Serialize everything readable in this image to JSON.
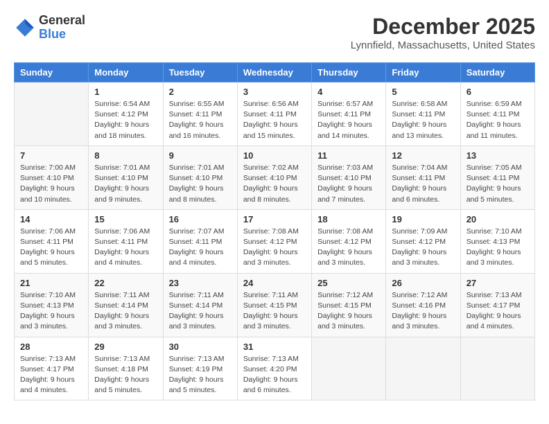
{
  "header": {
    "logo_line1": "General",
    "logo_line2": "Blue",
    "month_title": "December 2025",
    "location": "Lynnfield, Massachusetts, United States"
  },
  "calendar": {
    "weekdays": [
      "Sunday",
      "Monday",
      "Tuesday",
      "Wednesday",
      "Thursday",
      "Friday",
      "Saturday"
    ],
    "weeks": [
      [
        {
          "day": "",
          "info": ""
        },
        {
          "day": "1",
          "info": "Sunrise: 6:54 AM\nSunset: 4:12 PM\nDaylight: 9 hours\nand 18 minutes."
        },
        {
          "day": "2",
          "info": "Sunrise: 6:55 AM\nSunset: 4:11 PM\nDaylight: 9 hours\nand 16 minutes."
        },
        {
          "day": "3",
          "info": "Sunrise: 6:56 AM\nSunset: 4:11 PM\nDaylight: 9 hours\nand 15 minutes."
        },
        {
          "day": "4",
          "info": "Sunrise: 6:57 AM\nSunset: 4:11 PM\nDaylight: 9 hours\nand 14 minutes."
        },
        {
          "day": "5",
          "info": "Sunrise: 6:58 AM\nSunset: 4:11 PM\nDaylight: 9 hours\nand 13 minutes."
        },
        {
          "day": "6",
          "info": "Sunrise: 6:59 AM\nSunset: 4:11 PM\nDaylight: 9 hours\nand 11 minutes."
        }
      ],
      [
        {
          "day": "7",
          "info": "Sunrise: 7:00 AM\nSunset: 4:10 PM\nDaylight: 9 hours\nand 10 minutes."
        },
        {
          "day": "8",
          "info": "Sunrise: 7:01 AM\nSunset: 4:10 PM\nDaylight: 9 hours\nand 9 minutes."
        },
        {
          "day": "9",
          "info": "Sunrise: 7:01 AM\nSunset: 4:10 PM\nDaylight: 9 hours\nand 8 minutes."
        },
        {
          "day": "10",
          "info": "Sunrise: 7:02 AM\nSunset: 4:10 PM\nDaylight: 9 hours\nand 8 minutes."
        },
        {
          "day": "11",
          "info": "Sunrise: 7:03 AM\nSunset: 4:10 PM\nDaylight: 9 hours\nand 7 minutes."
        },
        {
          "day": "12",
          "info": "Sunrise: 7:04 AM\nSunset: 4:11 PM\nDaylight: 9 hours\nand 6 minutes."
        },
        {
          "day": "13",
          "info": "Sunrise: 7:05 AM\nSunset: 4:11 PM\nDaylight: 9 hours\nand 5 minutes."
        }
      ],
      [
        {
          "day": "14",
          "info": "Sunrise: 7:06 AM\nSunset: 4:11 PM\nDaylight: 9 hours\nand 5 minutes."
        },
        {
          "day": "15",
          "info": "Sunrise: 7:06 AM\nSunset: 4:11 PM\nDaylight: 9 hours\nand 4 minutes."
        },
        {
          "day": "16",
          "info": "Sunrise: 7:07 AM\nSunset: 4:11 PM\nDaylight: 9 hours\nand 4 minutes."
        },
        {
          "day": "17",
          "info": "Sunrise: 7:08 AM\nSunset: 4:12 PM\nDaylight: 9 hours\nand 3 minutes."
        },
        {
          "day": "18",
          "info": "Sunrise: 7:08 AM\nSunset: 4:12 PM\nDaylight: 9 hours\nand 3 minutes."
        },
        {
          "day": "19",
          "info": "Sunrise: 7:09 AM\nSunset: 4:12 PM\nDaylight: 9 hours\nand 3 minutes."
        },
        {
          "day": "20",
          "info": "Sunrise: 7:10 AM\nSunset: 4:13 PM\nDaylight: 9 hours\nand 3 minutes."
        }
      ],
      [
        {
          "day": "21",
          "info": "Sunrise: 7:10 AM\nSunset: 4:13 PM\nDaylight: 9 hours\nand 3 minutes."
        },
        {
          "day": "22",
          "info": "Sunrise: 7:11 AM\nSunset: 4:14 PM\nDaylight: 9 hours\nand 3 minutes."
        },
        {
          "day": "23",
          "info": "Sunrise: 7:11 AM\nSunset: 4:14 PM\nDaylight: 9 hours\nand 3 minutes."
        },
        {
          "day": "24",
          "info": "Sunrise: 7:11 AM\nSunset: 4:15 PM\nDaylight: 9 hours\nand 3 minutes."
        },
        {
          "day": "25",
          "info": "Sunrise: 7:12 AM\nSunset: 4:15 PM\nDaylight: 9 hours\nand 3 minutes."
        },
        {
          "day": "26",
          "info": "Sunrise: 7:12 AM\nSunset: 4:16 PM\nDaylight: 9 hours\nand 3 minutes."
        },
        {
          "day": "27",
          "info": "Sunrise: 7:13 AM\nSunset: 4:17 PM\nDaylight: 9 hours\nand 4 minutes."
        }
      ],
      [
        {
          "day": "28",
          "info": "Sunrise: 7:13 AM\nSunset: 4:17 PM\nDaylight: 9 hours\nand 4 minutes."
        },
        {
          "day": "29",
          "info": "Sunrise: 7:13 AM\nSunset: 4:18 PM\nDaylight: 9 hours\nand 5 minutes."
        },
        {
          "day": "30",
          "info": "Sunrise: 7:13 AM\nSunset: 4:19 PM\nDaylight: 9 hours\nand 5 minutes."
        },
        {
          "day": "31",
          "info": "Sunrise: 7:13 AM\nSunset: 4:20 PM\nDaylight: 9 hours\nand 6 minutes."
        },
        {
          "day": "",
          "info": ""
        },
        {
          "day": "",
          "info": ""
        },
        {
          "day": "",
          "info": ""
        }
      ]
    ]
  }
}
